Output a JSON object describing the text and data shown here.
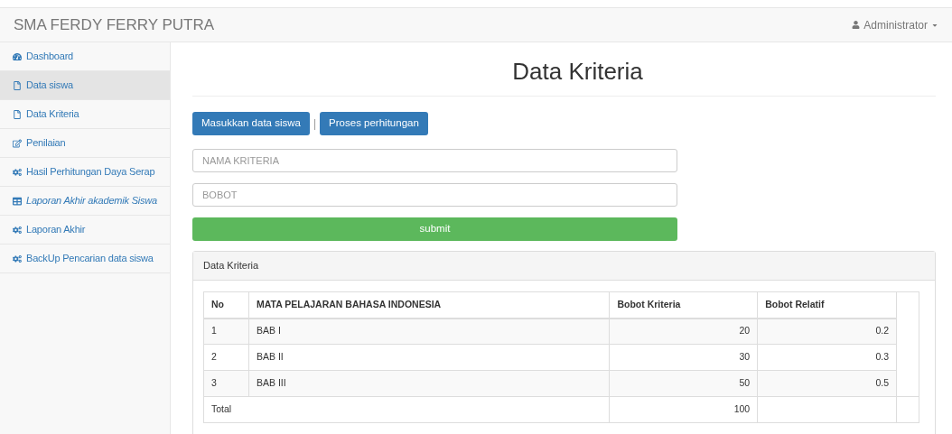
{
  "navbar": {
    "brand": "SMA FERDY FERRY PUTRA",
    "user": "Administrator"
  },
  "sidebar": {
    "items": [
      {
        "label": "Dashboard",
        "selected": false,
        "italic": false
      },
      {
        "label": "Data siswa",
        "selected": true,
        "italic": false
      },
      {
        "label": "Data Kriteria",
        "selected": false,
        "italic": false
      },
      {
        "label": "Penilaian",
        "selected": false,
        "italic": false
      },
      {
        "label": "Hasil Perhitungan Daya Serap",
        "selected": false,
        "italic": false
      },
      {
        "label": "Laporan Akhir akademik Siswa",
        "selected": false,
        "italic": true
      },
      {
        "label": "Laporan Akhir",
        "selected": false,
        "italic": false
      },
      {
        "label": "BackUp Pencarian data siswa",
        "selected": false,
        "italic": false
      }
    ]
  },
  "page_title": "Data Kriteria",
  "actions": {
    "buttons": [
      "Masukkan data siswa",
      "Proses perhitungan"
    ],
    "separator": "|"
  },
  "form": {
    "fields": [
      {
        "placeholder": "NAMA KRITERIA"
      },
      {
        "placeholder": "BOBOT"
      }
    ],
    "submit": "submit"
  },
  "panel": {
    "title": "Data Kriteria",
    "table": {
      "columns": [
        "No",
        "MATA PELAJARAN BAHASA INDONESIA",
        "Bobot Kriteria",
        "Bobot Relatif"
      ],
      "rows": [
        [
          "1",
          "BAB I",
          "20",
          "0.2"
        ],
        [
          "2",
          "BAB II",
          "30",
          "0.3"
        ],
        [
          "3",
          "BAB III",
          "50",
          "0.5"
        ]
      ],
      "total": {
        "label": "Total",
        "value": "100"
      }
    }
  }
}
